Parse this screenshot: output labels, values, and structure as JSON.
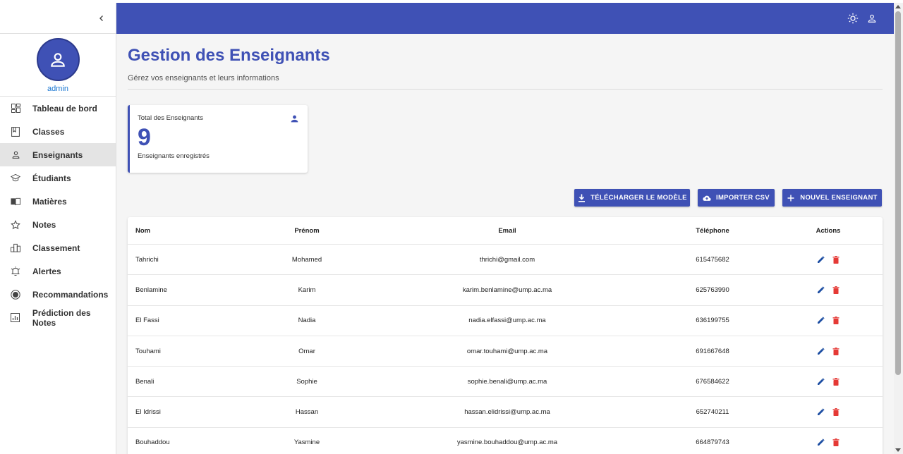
{
  "sidebar": {
    "username": "admin",
    "items": [
      {
        "label": "Tableau de bord",
        "icon": "dashboard-icon"
      },
      {
        "label": "Classes",
        "icon": "book-icon"
      },
      {
        "label": "Enseignants",
        "icon": "person-icon",
        "active": true
      },
      {
        "label": "Étudiants",
        "icon": "graduation-cap-icon"
      },
      {
        "label": "Matières",
        "icon": "open-book-icon"
      },
      {
        "label": "Notes",
        "icon": "star-icon"
      },
      {
        "label": "Classement",
        "icon": "podium-icon"
      },
      {
        "label": "Alertes",
        "icon": "alarm-icon"
      },
      {
        "label": "Recommandations",
        "icon": "recommend-icon"
      },
      {
        "label": "Prédiction des Notes",
        "icon": "chart-icon"
      }
    ]
  },
  "header": {
    "icons": [
      "theme-sun-icon",
      "account-icon"
    ],
    "color": "#3f51b5"
  },
  "page": {
    "title": "Gestion des Enseignants",
    "subtitle": "Gérez vos enseignants et leurs informations"
  },
  "stat": {
    "title": "Total des Enseignants",
    "value": "9",
    "caption": "Enseignants enregistrés"
  },
  "actions": {
    "download_label": "TÉLÉCHARGER LE MODÈLE",
    "import_label": "IMPORTER CSV",
    "new_label": "NOUVEL ENSEIGNANT"
  },
  "table": {
    "headers": {
      "nom": "Nom",
      "prenom": "Prénom",
      "email": "Email",
      "telephone": "Téléphone",
      "actions": "Actions"
    },
    "rows": [
      {
        "nom": "Tahrichi",
        "prenom": "Mohamed",
        "email": "thrichi@gmail.com",
        "telephone": "615475682"
      },
      {
        "nom": "Benlamine",
        "prenom": "Karim",
        "email": "karim.benlamine@ump.ac.ma",
        "telephone": "625763990"
      },
      {
        "nom": "El Fassi",
        "prenom": "Nadia",
        "email": "nadia.elfassi@ump.ac.ma",
        "telephone": "636199755"
      },
      {
        "nom": "Touhami",
        "prenom": "Omar",
        "email": "omar.touhami@ump.ac.ma",
        "telephone": "691667648"
      },
      {
        "nom": "Benali",
        "prenom": "Sophie",
        "email": "sophie.benali@ump.ac.ma",
        "telephone": "676584622"
      },
      {
        "nom": "El Idrissi",
        "prenom": "Hassan",
        "email": "hassan.elidrissi@ump.ac.ma",
        "telephone": "652740211"
      },
      {
        "nom": "Bouhaddou",
        "prenom": "Yasmine",
        "email": "yasmine.bouhaddou@ump.ac.ma",
        "telephone": "664879743"
      }
    ]
  },
  "colors": {
    "accent": "#3f51b5",
    "delete": "#e53935",
    "edit": "#1e4fa3",
    "link": "#1976d2"
  }
}
